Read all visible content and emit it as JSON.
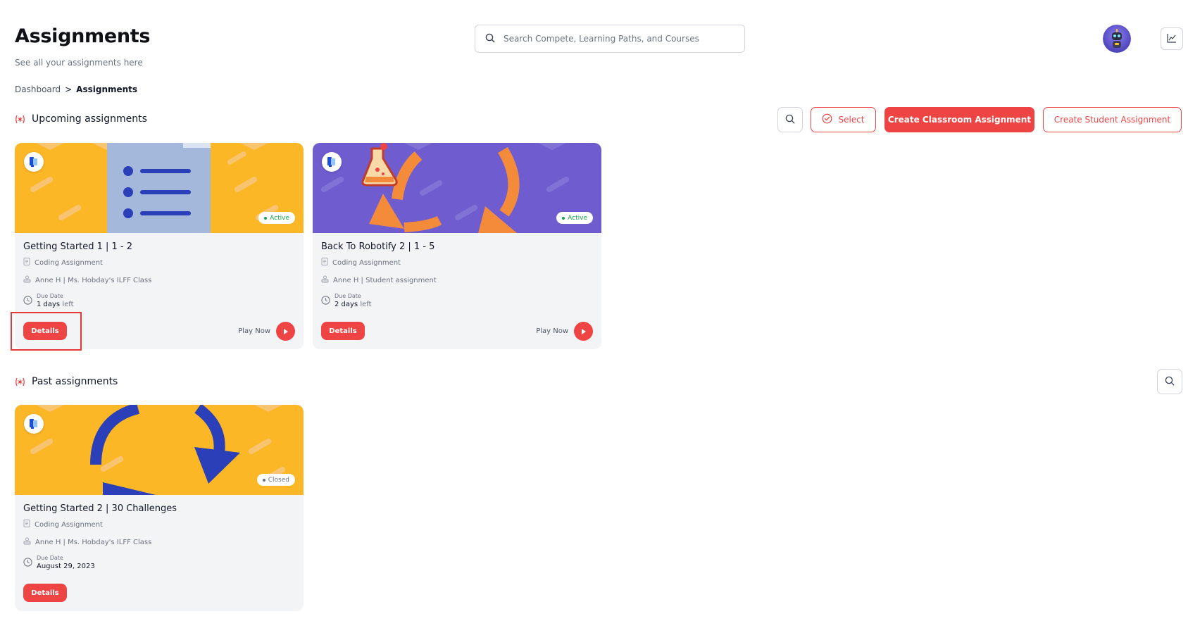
{
  "header": {
    "title": "Assignments",
    "subtitle": "See all your assignments here",
    "search_placeholder": "Search Compete, Learning Paths, and Courses"
  },
  "breadcrumb": {
    "parent": "Dashboard",
    "separator": ">",
    "current": "Assignments"
  },
  "upcoming": {
    "title": "Upcoming assignments",
    "select_label": "Select",
    "create_classroom_label": "Create Classroom Assignment",
    "create_student_label": "Create Student Assignment",
    "cards": [
      {
        "title": "Getting Started 1 | 1 - 2",
        "type": "Coding Assignment",
        "assignee": "Anne H | Ms. Hobday's ILFF Class",
        "due_label": "Due Date",
        "due_value": "1 days",
        "due_suffix": "left",
        "status": "Active",
        "details_label": "Details",
        "play_label": "Play Now",
        "theme": "yellow-list"
      },
      {
        "title": "Back To Robotify 2 | 1 - 5",
        "type": "Coding Assignment",
        "assignee": "Anne H | Student assignment",
        "due_label": "Due Date",
        "due_value": "2 days",
        "due_suffix": "left",
        "status": "Active",
        "details_label": "Details",
        "play_label": "Play Now",
        "theme": "purple-flask"
      }
    ]
  },
  "past": {
    "title": "Past assignments",
    "cards": [
      {
        "title": "Getting Started 2 | 30 Challenges",
        "type": "Coding Assignment",
        "assignee": "Anne H | Ms. Hobday's ILFF Class",
        "due_label": "Due Date",
        "due_value": "August 29, 2023",
        "status": "Closed",
        "details_label": "Details",
        "theme": "yellow-arrows"
      }
    ]
  },
  "colors": {
    "accent": "#ef4444",
    "active_green": "#16a34a",
    "closed_gray": "#6b7280",
    "yellow": "#fbb726",
    "purple": "#6f5ccf",
    "card_bg": "#f3f4f6"
  }
}
